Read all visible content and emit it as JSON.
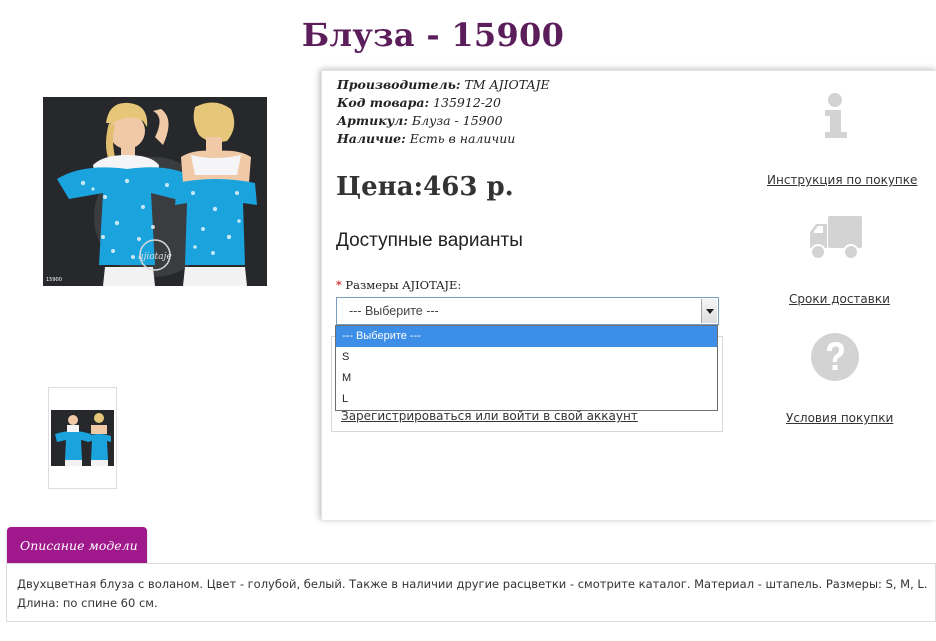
{
  "product": {
    "title": "Блуза - 15900",
    "manufacturer_label": "Производитель:",
    "manufacturer_value": "ТМ AJIOTAJE",
    "code_label": "Код товара:",
    "code_value": "135912-20",
    "sku_label": "Артикул:",
    "sku_value": "Блуза - 15900",
    "availability_label": "Наличие:",
    "availability_value": "Есть в наличии",
    "price": "Цена:463 р.",
    "image_label": "15900"
  },
  "options": {
    "title": "Доступные варианты",
    "required_mark": "*",
    "size_label": "Размеры AJIOTAJE:",
    "selected": "--- Выберите ---",
    "dropdown": [
      "--- Выберите ---",
      "S",
      "M",
      "L"
    ]
  },
  "login_link": "Зарегистрироваться или войти в свой аккаунт",
  "sidebar": {
    "info_link": "Инструкция по покупке",
    "delivery_link": "Сроки доставки",
    "terms_link": "Условия покупки"
  },
  "description": {
    "tab_label": "Описание модели",
    "text": "Двухцветная блуза с воланом. Цвет - голубой, белый. Также в наличии другие расцветки - смотрите каталог. Материал - штапель. Размеры: S, M, L. Длина: по спине 60 см."
  },
  "colors": {
    "title": "#5b1e5a",
    "tab": "#a0198c",
    "dropdown_highlight": "#3c8ee6",
    "icon_gray": "#d5d5d5"
  },
  "icons": [
    "info-icon",
    "truck-icon",
    "question-icon"
  ]
}
